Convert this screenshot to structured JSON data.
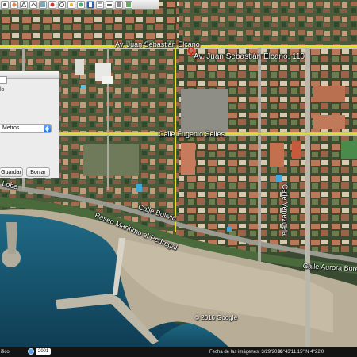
{
  "toolbar": {
    "buttons": [
      "hand-tool-icon",
      "placemark-icon",
      "polygon-icon",
      "path-icon",
      "overlay-icon",
      "record-tour-icon",
      "historical-imagery-icon",
      "sun-icon",
      "planets-icon",
      "ruler-icon",
      "email-icon",
      "print-icon",
      "save-image-icon",
      "view-in-maps-icon"
    ]
  },
  "map_labels": {
    "street_elcano": "Av. Juan Sebastián Elcano",
    "pin_label": "Av. Juan Sebastián Elcano, 110",
    "street_selles": "Calle Eugenio Sellés",
    "street_venezuela": "Calle Venezuela",
    "street_bolivia": "Calle Bolivia",
    "street_paseo": "Paseo Marítimo el Pedregal",
    "street_aurora": "Calle Aurora Bore",
    "street_lobe": "Lobe"
  },
  "ruler_panel": {
    "partial_label": "lo",
    "unit_select": "Metros",
    "save_button": "Guardar",
    "clear_button": "Borrar"
  },
  "status_bar": {
    "layer_label": "ifico",
    "historical_year": "2001",
    "image_date": "Fecha de las imágenes: 3/29/2016",
    "coordinates": "36°43'11.15\" N    4°22'0"
  },
  "copyright": "© 2016 Google",
  "colors": {
    "road_yellow": "#e8e21a",
    "pin_red": "#e02020",
    "select_arrow_blue": "#1c6fe8",
    "sea_blue": "#15506e"
  }
}
